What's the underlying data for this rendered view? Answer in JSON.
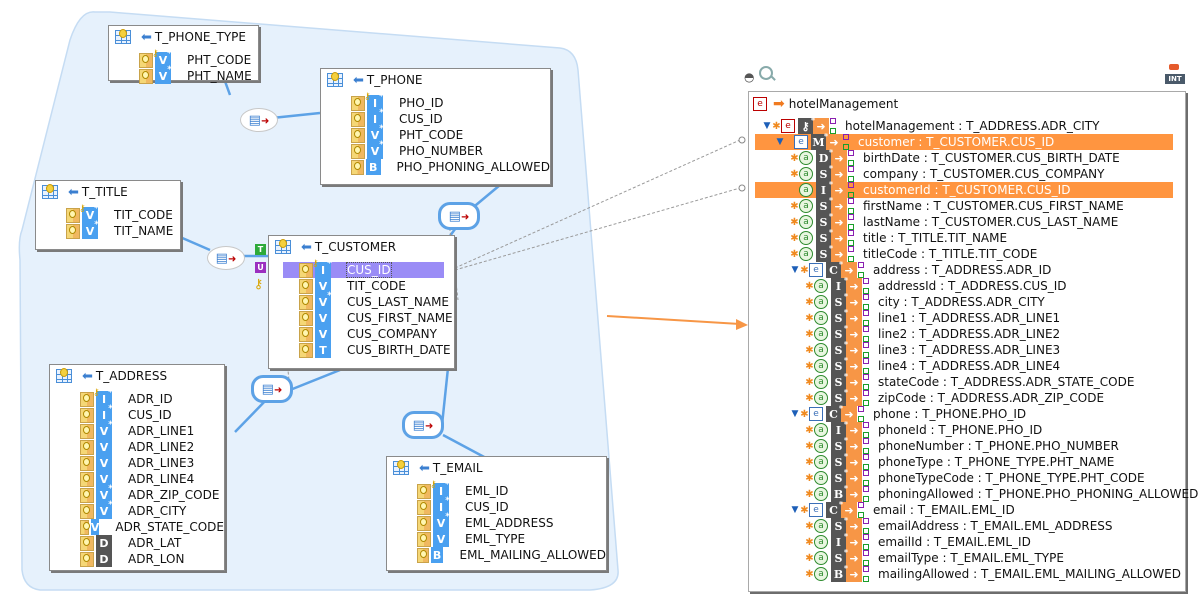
{
  "diagram": {
    "tables": [
      {
        "id": "t_phone_type",
        "name": "T_PHONE_TYPE",
        "columns": [
          {
            "name": "PHT_CODE",
            "type": "V",
            "pk": true,
            "required": true
          },
          {
            "name": "PHT_NAME",
            "type": "V",
            "pk": false,
            "required": true
          }
        ]
      },
      {
        "id": "t_phone",
        "name": "T_PHONE",
        "columns": [
          {
            "name": "PHO_ID",
            "type": "I",
            "pk": true,
            "required": true
          },
          {
            "name": "CUS_ID",
            "type": "I",
            "pk": false,
            "required": true
          },
          {
            "name": "PHT_CODE",
            "type": "V",
            "pk": false,
            "required": true
          },
          {
            "name": "PHO_NUMBER",
            "type": "V",
            "pk": false,
            "required": true
          },
          {
            "name": "PHO_PHONING_ALLOWED",
            "type": "B",
            "pk": false,
            "required": false
          }
        ]
      },
      {
        "id": "t_title",
        "name": "T_TITLE",
        "columns": [
          {
            "name": "TIT_CODE",
            "type": "V",
            "pk": true,
            "required": true
          },
          {
            "name": "TIT_NAME",
            "type": "V",
            "pk": false,
            "required": true
          }
        ]
      },
      {
        "id": "t_customer",
        "name": "T_CUSTOMER",
        "columns": [
          {
            "name": "CUS_ID",
            "type": "I",
            "pk": true,
            "required": true,
            "selected": true
          },
          {
            "name": "TIT_CODE",
            "type": "V",
            "pk": false,
            "required": false
          },
          {
            "name": "CUS_LAST_NAME",
            "type": "V",
            "pk": false,
            "required": true
          },
          {
            "name": "CUS_FIRST_NAME",
            "type": "V",
            "pk": false,
            "required": false
          },
          {
            "name": "CUS_COMPANY",
            "type": "V",
            "pk": false,
            "required": false
          },
          {
            "name": "CUS_BIRTH_DATE",
            "type": "T",
            "pk": false,
            "required": false
          }
        ]
      },
      {
        "id": "t_address",
        "name": "T_ADDRESS",
        "columns": [
          {
            "name": "ADR_ID",
            "type": "I",
            "pk": true,
            "required": true
          },
          {
            "name": "CUS_ID",
            "type": "I",
            "pk": false,
            "required": true
          },
          {
            "name": "ADR_LINE1",
            "type": "V",
            "pk": false,
            "required": true
          },
          {
            "name": "ADR_LINE2",
            "type": "V",
            "pk": false,
            "required": false
          },
          {
            "name": "ADR_LINE3",
            "type": "V",
            "pk": false,
            "required": false
          },
          {
            "name": "ADR_LINE4",
            "type": "V",
            "pk": false,
            "required": false
          },
          {
            "name": "ADR_ZIP_CODE",
            "type": "V",
            "pk": false,
            "required": true
          },
          {
            "name": "ADR_CITY",
            "type": "V",
            "pk": false,
            "required": true
          },
          {
            "name": "ADR_STATE_CODE",
            "type": "V",
            "pk": false,
            "required": false
          },
          {
            "name": "ADR_LAT",
            "type": "D",
            "pk": false,
            "required": false
          },
          {
            "name": "ADR_LON",
            "type": "D",
            "pk": false,
            "required": false
          }
        ]
      },
      {
        "id": "t_email",
        "name": "T_EMAIL",
        "columns": [
          {
            "name": "EML_ID",
            "type": "I",
            "pk": true,
            "required": true
          },
          {
            "name": "CUS_ID",
            "type": "I",
            "pk": false,
            "required": true
          },
          {
            "name": "EML_ADDRESS",
            "type": "V",
            "pk": false,
            "required": true
          },
          {
            "name": "EML_TYPE",
            "type": "V",
            "pk": false,
            "required": false
          },
          {
            "name": "EML_MAILING_ALLOWED",
            "type": "B",
            "pk": false,
            "required": false
          }
        ]
      }
    ],
    "relationships": [
      {
        "from": "t_phone",
        "to": "t_phone_type"
      },
      {
        "from": "t_customer",
        "to": "t_title"
      },
      {
        "from": "t_phone",
        "to": "t_customer"
      },
      {
        "from": "t_address",
        "to": "t_customer"
      },
      {
        "from": "t_email",
        "to": "t_customer"
      }
    ],
    "customer_badges": [
      "T",
      "U",
      "key"
    ],
    "colors": {
      "group_fill": "#e6f1fc",
      "group_stroke": "#c5dcf3",
      "link": "#5da2e6",
      "selected_row": "#9a8cf6",
      "mapping_arrow": "#f79646"
    }
  },
  "tree": {
    "root_label": "hotelManagement",
    "icons": [
      "eye-icon",
      "search-icon",
      "int-icon"
    ],
    "rows": [
      {
        "level": 0,
        "kind": "entity",
        "toggle": true,
        "star": true,
        "type": "key",
        "label": "hotelManagement : T_ADDRESS.ADR_CITY",
        "highlight": false
      },
      {
        "level": 1,
        "kind": "entity",
        "toggle": true,
        "star": false,
        "type": "M",
        "label": "customer : T_CUSTOMER.CUS_ID",
        "highlight": true
      },
      {
        "level": 2,
        "kind": "attr",
        "star": true,
        "type": "D",
        "label": "birthDate : T_CUSTOMER.CUS_BIRTH_DATE",
        "highlight": false
      },
      {
        "level": 2,
        "kind": "attr",
        "star": true,
        "type": "S",
        "label": "company : T_CUSTOMER.CUS_COMPANY",
        "highlight": false
      },
      {
        "level": 2,
        "kind": "attr",
        "star": false,
        "type": "I",
        "label": "customerId : T_CUSTOMER.CUS_ID",
        "highlight": true
      },
      {
        "level": 2,
        "kind": "attr",
        "star": true,
        "type": "S",
        "label": "firstName : T_CUSTOMER.CUS_FIRST_NAME",
        "highlight": false
      },
      {
        "level": 2,
        "kind": "attr",
        "star": true,
        "type": "S",
        "label": "lastName : T_CUSTOMER.CUS_LAST_NAME",
        "highlight": false
      },
      {
        "level": 2,
        "kind": "attr",
        "star": true,
        "type": "S",
        "label": "title : T_TITLE.TIT_NAME",
        "highlight": false
      },
      {
        "level": 2,
        "kind": "attr",
        "star": true,
        "type": "S",
        "label": "titleCode : T_TITLE.TIT_CODE",
        "highlight": false
      },
      {
        "level": 2,
        "kind": "entity",
        "toggle": true,
        "star": true,
        "type": "C",
        "label": "address : T_ADDRESS.ADR_ID",
        "highlight": false
      },
      {
        "level": 3,
        "kind": "attr",
        "star": true,
        "type": "I",
        "label": "addressId : T_ADDRESS.CUS_ID",
        "highlight": false
      },
      {
        "level": 3,
        "kind": "attr",
        "star": true,
        "type": "S",
        "label": "city : T_ADDRESS.ADR_CITY",
        "highlight": false
      },
      {
        "level": 3,
        "kind": "attr",
        "star": true,
        "type": "S",
        "label": "line1 : T_ADDRESS.ADR_LINE1",
        "highlight": false
      },
      {
        "level": 3,
        "kind": "attr",
        "star": true,
        "type": "S",
        "label": "line2 : T_ADDRESS.ADR_LINE2",
        "highlight": false
      },
      {
        "level": 3,
        "kind": "attr",
        "star": true,
        "type": "S",
        "label": "line3 : T_ADDRESS.ADR_LINE3",
        "highlight": false
      },
      {
        "level": 3,
        "kind": "attr",
        "star": true,
        "type": "S",
        "label": "line4 : T_ADDRESS.ADR_LINE4",
        "highlight": false
      },
      {
        "level": 3,
        "kind": "attr",
        "star": true,
        "type": "S",
        "label": "stateCode : T_ADDRESS.ADR_STATE_CODE",
        "highlight": false
      },
      {
        "level": 3,
        "kind": "attr",
        "star": true,
        "type": "S",
        "label": "zipCode : T_ADDRESS.ADR_ZIP_CODE",
        "highlight": false
      },
      {
        "level": 2,
        "kind": "entity",
        "toggle": true,
        "star": true,
        "type": "C",
        "label": "phone : T_PHONE.PHO_ID",
        "highlight": false
      },
      {
        "level": 3,
        "kind": "attr",
        "star": true,
        "type": "I",
        "label": "phoneId : T_PHONE.PHO_ID",
        "highlight": false
      },
      {
        "level": 3,
        "kind": "attr",
        "star": true,
        "type": "S",
        "label": "phoneNumber : T_PHONE.PHO_NUMBER",
        "highlight": false
      },
      {
        "level": 3,
        "kind": "attr",
        "star": true,
        "type": "S",
        "label": "phoneType : T_PHONE_TYPE.PHT_NAME",
        "highlight": false
      },
      {
        "level": 3,
        "kind": "attr",
        "star": true,
        "type": "S",
        "label": "phoneTypeCode : T_PHONE_TYPE.PHT_CODE",
        "highlight": false
      },
      {
        "level": 3,
        "kind": "attr",
        "star": true,
        "type": "B",
        "label": "phoningAllowed : T_PHONE.PHO_PHONING_ALLOWED",
        "highlight": false
      },
      {
        "level": 2,
        "kind": "entity",
        "toggle": true,
        "star": true,
        "type": "C",
        "label": "email : T_EMAIL.EML_ID",
        "highlight": false
      },
      {
        "level": 3,
        "kind": "attr",
        "star": true,
        "type": "S",
        "label": "emailAddress : T_EMAIL.EML_ADDRESS",
        "highlight": false
      },
      {
        "level": 3,
        "kind": "attr",
        "star": true,
        "type": "I",
        "label": "emailId : T_EMAIL.EML_ID",
        "highlight": false
      },
      {
        "level": 3,
        "kind": "attr",
        "star": true,
        "type": "S",
        "label": "emailType : T_EMAIL.EML_TYPE",
        "highlight": false
      },
      {
        "level": 3,
        "kind": "attr",
        "star": true,
        "type": "B",
        "label": "mailingAllowed : T_EMAIL.EML_MAILING_ALLOWED",
        "highlight": false
      }
    ]
  }
}
